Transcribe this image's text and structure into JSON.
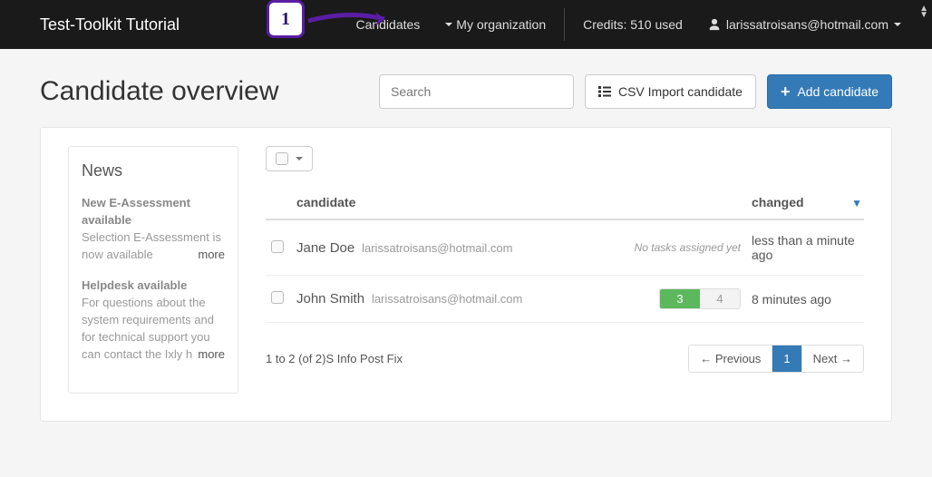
{
  "navbar": {
    "brand": "Test-Toolkit Tutorial",
    "candidates": "Candidates",
    "my_org": "My organization",
    "credits": "Credits: 510 used",
    "user": "larissatroisans@hotmail.com"
  },
  "annotation": {
    "num": "1"
  },
  "page": {
    "title": "Candidate overview",
    "search_placeholder": "Search",
    "csv_import": "CSV Import candidate",
    "add_candidate": "Add candidate"
  },
  "news": {
    "heading": "News",
    "items": [
      {
        "title": "New E-Assessment available",
        "body": "Selection E-Assessment is now available",
        "more": "more"
      },
      {
        "title": "Helpdesk available",
        "body": "For questions about the system requirements and for technical support you can contact the Ixly he...",
        "more": "more"
      }
    ]
  },
  "table": {
    "col_candidate": "candidate",
    "col_changed": "changed",
    "rows": [
      {
        "name": "Jane Doe",
        "email": "larissatroisans@hotmail.com",
        "tasks_text": "No tasks assigned yet",
        "changed": "less than a minute ago"
      },
      {
        "name": "John Smith",
        "email": "larissatroisans@hotmail.com",
        "tasks_done": "3",
        "tasks_pending": "4",
        "changed": "8 minutes ago"
      }
    ],
    "range": "1 to 2 (of 2)S Info Post Fix",
    "pager": {
      "prev": "← Previous",
      "page1": "1",
      "next": "Next →"
    }
  }
}
